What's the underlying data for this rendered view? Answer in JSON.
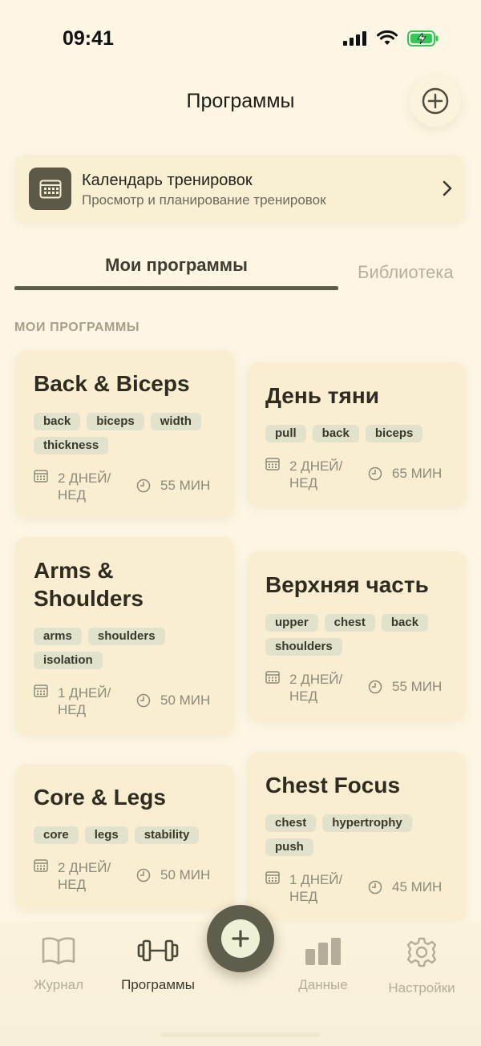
{
  "status": {
    "time": "09:41"
  },
  "header": {
    "title": "Программы"
  },
  "calendar": {
    "title": "Календарь тренировок",
    "subtitle": "Просмотр и планирование тренировок"
  },
  "tabs": {
    "mine": "Мои программы",
    "library": "Библиотека"
  },
  "section_label": "МОИ ПРОГРАММЫ",
  "programs": [
    {
      "title": "Back & Biceps",
      "tags": [
        "back",
        "biceps",
        "width",
        "thickness"
      ],
      "days": "2 ДНЕЙ/ НЕД",
      "duration": "55 МИН"
    },
    {
      "title": "День тяни",
      "tags": [
        "pull",
        "back",
        "biceps"
      ],
      "days": "2 ДНЕЙ/ НЕД",
      "duration": "65 МИН"
    },
    {
      "title": "Arms & Shoulders",
      "tags": [
        "arms",
        "shoulders",
        "isolation"
      ],
      "days": "1 ДНЕЙ/ НЕД",
      "duration": "50 МИН"
    },
    {
      "title": "Верхняя часть",
      "tags": [
        "upper",
        "chest",
        "back",
        "shoulders"
      ],
      "days": "2 ДНЕЙ/ НЕД",
      "duration": "55 МИН"
    },
    {
      "title": "Core & Legs",
      "tags": [
        "core",
        "legs",
        "stability"
      ],
      "days": "2 ДНЕЙ/ НЕД",
      "duration": "50 МИН"
    },
    {
      "title": "Chest Focus",
      "tags": [
        "chest",
        "hypertrophy",
        "push"
      ],
      "days": "1 ДНЕЙ/ НЕД",
      "duration": "45 МИН"
    }
  ],
  "tabbar": {
    "journal": "Журнал",
    "programs": "Программы",
    "data": "Данные",
    "settings": "Настройки"
  },
  "colors": {
    "background": "#fdf6e4",
    "card": "#f9eed1",
    "accent": "#5f5d4b",
    "tag": "#e2e2cc",
    "battery": "#34c759"
  }
}
